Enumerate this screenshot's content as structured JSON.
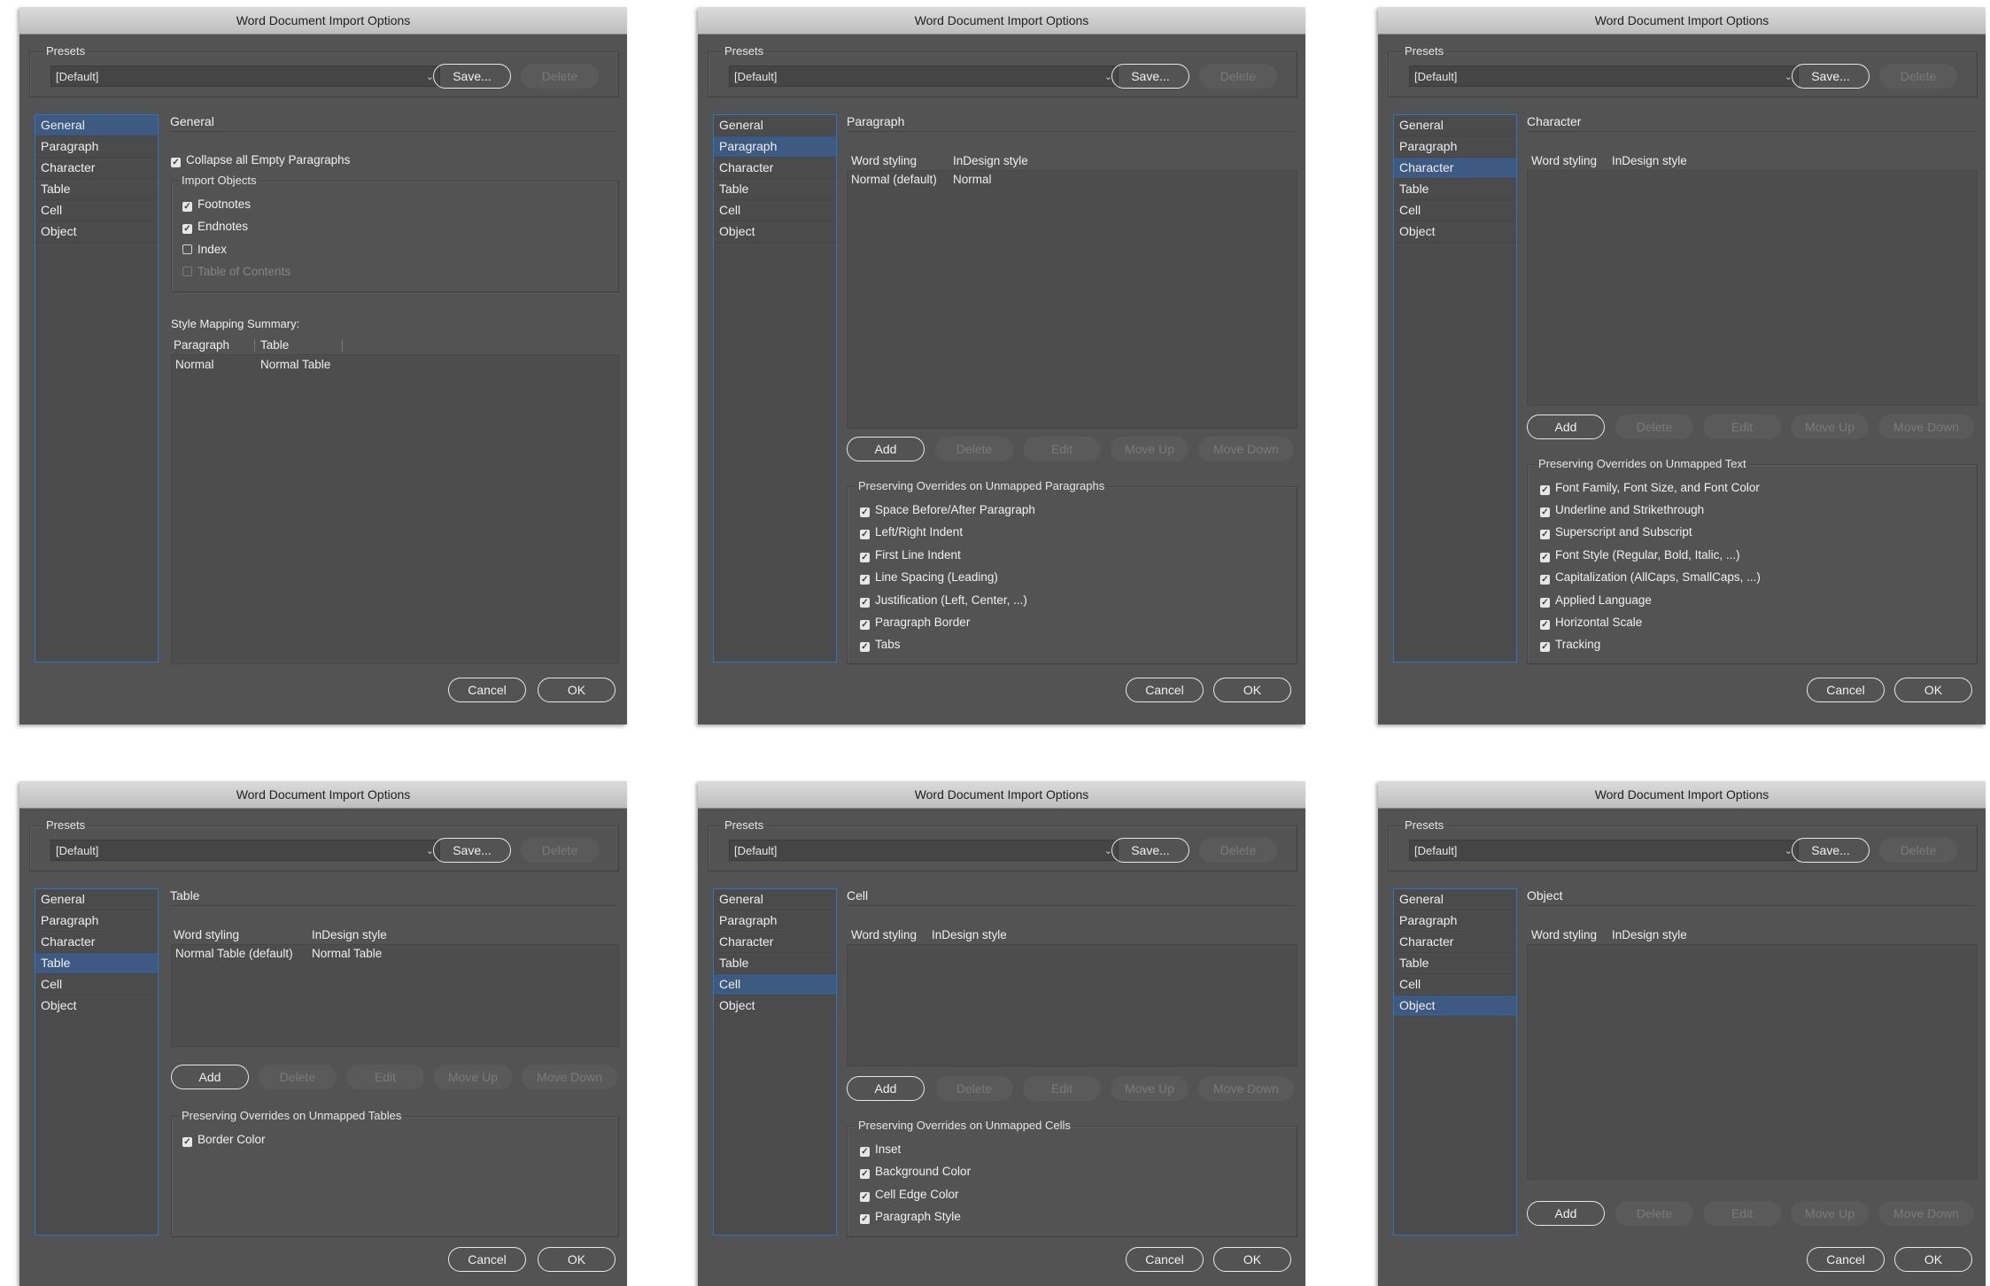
{
  "common": {
    "window_title": "Word Document Import Options",
    "presets_label": "Presets",
    "preset_value": "[Default]",
    "save_label": "Save...",
    "delete_label": "Delete",
    "cancel_label": "Cancel",
    "ok_label": "OK",
    "nav": [
      "General",
      "Paragraph",
      "Character",
      "Table",
      "Cell",
      "Object"
    ],
    "list_buttons": [
      "Add",
      "Delete",
      "Edit",
      "Move Up",
      "Move Down"
    ],
    "word_styling": "Word styling",
    "indesign_style": "InDesign style"
  },
  "general": {
    "title": "General",
    "collapse": "Collapse all Empty Paragraphs",
    "import_objects": "Import Objects",
    "footnotes": "Footnotes",
    "endnotes": "Endnotes",
    "index": "Index",
    "toc": "Table of Contents",
    "summary_label": "Style Mapping Summary:",
    "col_paragraph": "Paragraph",
    "col_table": "Table",
    "row_paragraph": "Normal",
    "row_table": "Normal Table"
  },
  "paragraph": {
    "title": "Paragraph",
    "row_word": "Normal (default)",
    "row_indesign": "Normal",
    "overrides_label": "Preserving Overrides on Unmapped Paragraphs",
    "overrides": [
      "Space Before/After Paragraph",
      "Left/Right Indent",
      "First Line Indent",
      "Line Spacing (Leading)",
      "Justification (Left, Center, ...)",
      "Paragraph Border",
      "Tabs"
    ]
  },
  "character": {
    "title": "Character",
    "overrides_label": "Preserving Overrides on Unmapped Text",
    "overrides": [
      "Font Family, Font Size, and Font Color",
      "Underline and Strikethrough",
      "Superscript and Subscript",
      "Font Style (Regular, Bold, Italic, ...)",
      "Capitalization (AllCaps, SmallCaps, ...)",
      "Applied Language",
      "Horizontal Scale",
      "Tracking"
    ]
  },
  "table": {
    "title": "Table",
    "row_word": "Normal Table (default)",
    "row_indesign": "Normal Table",
    "overrides_label": "Preserving Overrides on Unmapped Tables",
    "overrides": [
      "Border Color"
    ]
  },
  "cell": {
    "title": "Cell",
    "overrides_label": "Preserving Overrides on Unmapped Cells",
    "overrides": [
      "Inset",
      "Background Color",
      "Cell Edge Color",
      "Paragraph Style"
    ]
  },
  "object": {
    "title": "Object"
  }
}
